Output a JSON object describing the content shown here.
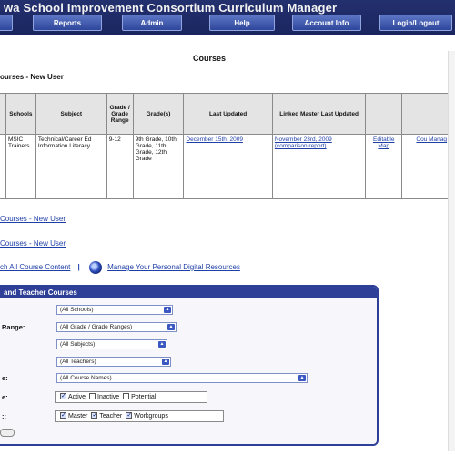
{
  "header": {
    "title": "wa School Improvement Consortium Curriculum Manager",
    "nav": [
      {
        "label": ""
      },
      {
        "label": "Reports"
      },
      {
        "label": "Admin"
      },
      {
        "label": "Help"
      },
      {
        "label": "Account Info"
      },
      {
        "label": "Login/Logout"
      }
    ]
  },
  "page_title": "Courses",
  "section_title": "ourses - New User",
  "table": {
    "headers": [
      "",
      "Schools",
      "Subject",
      "Grade / Grade Range",
      "Grade(s)",
      "Last Updated",
      "Linked Master Last Updated",
      "",
      ""
    ],
    "row": {
      "c0": "",
      "schools": "MSIC Trainers",
      "subject": "Technical/Career Ed Information Literacy",
      "grade_range": "9-12",
      "grades": "9th Grade, 10th Grade, 11th Grade, 12th Grade",
      "last_updated": "December 15th, 2009",
      "linked_master": "November 23rd, 2009 (comparison report)",
      "editable_map": "Editable Map",
      "course_manager": "Cou Manag"
    }
  },
  "links": {
    "link1": "Courses - New User",
    "link2": "Courses - New User",
    "search_all": "ch All Course Content",
    "separator": "|",
    "manage_resources": "Manage Your Personal Digital Resources"
  },
  "panel": {
    "title": "and Teacher Courses",
    "rows": {
      "range_label": "Range:",
      "name_label": "e:",
      "status_label": "e:",
      "type_label": "::"
    },
    "selects": {
      "schools": "(All Schools)",
      "grade_range": "(All Grade / Grade Ranges)",
      "subjects": "(All Subjects)",
      "teachers": "(All Teachers)",
      "course_names": "(All Course Names)"
    },
    "status_options": [
      {
        "label": "Active",
        "checked": true
      },
      {
        "label": "Inactive",
        "checked": false
      },
      {
        "label": "Potential",
        "checked": false
      }
    ],
    "type_options": [
      {
        "label": "Master",
        "checked": true
      },
      {
        "label": "Teacher",
        "checked": true
      },
      {
        "label": "Workgroups",
        "checked": true
      }
    ]
  },
  "colors": {
    "header_bg": "#1b2660",
    "nav_button": "#3d56ad",
    "link": "#1f3fa8",
    "panel_border": "#2e3f97"
  }
}
